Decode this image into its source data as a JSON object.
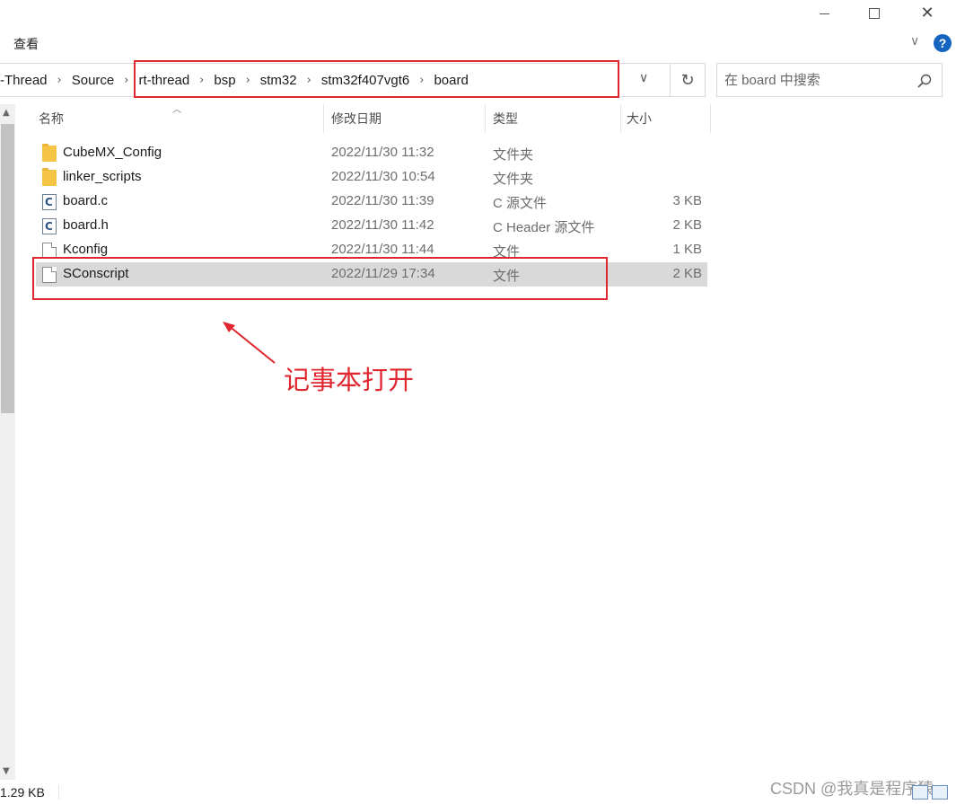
{
  "window": {
    "controls": {
      "minimize": "minimize",
      "maximize": "maximize",
      "close": "✕"
    }
  },
  "ribbon": {
    "tab_view": "查看",
    "expand_glyph": "∨",
    "help": "?"
  },
  "breadcrumb": {
    "items": [
      "-Thread",
      "Source",
      "rt-thread",
      "bsp",
      "stm32",
      "stm32f407vgt6",
      "board"
    ],
    "separator": "›"
  },
  "search": {
    "placeholder": "在 board 中搜索"
  },
  "columns": {
    "name": "名称",
    "date": "修改日期",
    "type": "类型",
    "size": "大小"
  },
  "files": [
    {
      "icon": "folder-icon",
      "name": "CubeMX_Config",
      "date": "2022/11/30 11:32",
      "type": "文件夹",
      "size": ""
    },
    {
      "icon": "folder-icon",
      "name": "linker_scripts",
      "date": "2022/11/30 10:54",
      "type": "文件夹",
      "size": ""
    },
    {
      "icon": "c-source-icon",
      "name": "board.c",
      "date": "2022/11/30 11:39",
      "type": "C 源文件",
      "size": "3 KB"
    },
    {
      "icon": "c-header-icon",
      "name": "board.h",
      "date": "2022/11/30 11:42",
      "type": "C Header 源文件",
      "size": "2 KB"
    },
    {
      "icon": "file-icon",
      "name": "Kconfig",
      "date": "2022/11/30 11:44",
      "type": "文件",
      "size": "1 KB"
    },
    {
      "icon": "file-icon",
      "name": "SConscript",
      "date": "2022/11/29 17:34",
      "type": "文件",
      "size": "2 KB",
      "selected": true
    }
  ],
  "annotation": {
    "text": "记事本打开",
    "color": "#e0262e"
  },
  "status": {
    "selection_size": "1.29 KB"
  },
  "watermark": "CSDN @我真是程序猿",
  "colors": {
    "highlight": "#e0262e",
    "selection": "#d9d9d9",
    "accent": "#1565c0"
  }
}
